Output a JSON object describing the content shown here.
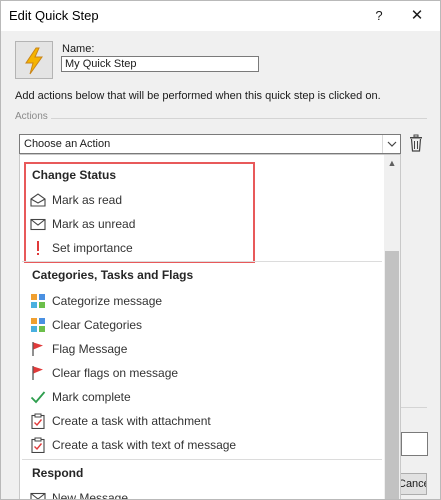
{
  "window": {
    "title": "Edit Quick Step",
    "help_label": "?",
    "close_label": "✕"
  },
  "quick_step": {
    "icon": "lightning-bolt-icon",
    "name_label": "Name:",
    "name_value": "My Quick Step"
  },
  "instructions": "Add actions below that will be performed when this quick step is clicked on.",
  "actions": {
    "section_label": "Actions",
    "select_value": "Choose an Action"
  },
  "dropdown": {
    "groups": [
      {
        "header": "Change Status",
        "items": [
          {
            "label": "Mark as read",
            "icon": "open-envelope-icon"
          },
          {
            "label": "Mark as unread",
            "icon": "envelope-icon"
          },
          {
            "label": "Set importance",
            "icon": "exclamation-icon"
          }
        ]
      },
      {
        "header": "Categories, Tasks and Flags",
        "items": [
          {
            "label": "Categorize message",
            "icon": "categorize-icon"
          },
          {
            "label": "Clear Categories",
            "icon": "clear-categories-icon"
          },
          {
            "label": "Flag Message",
            "icon": "red-flag-icon"
          },
          {
            "label": "Clear flags on message",
            "icon": "red-flag-icon"
          },
          {
            "label": "Mark complete",
            "icon": "green-check-icon"
          },
          {
            "label": "Create a task with attachment",
            "icon": "task-clipboard-icon"
          },
          {
            "label": "Create a task with text of message",
            "icon": "task-clipboard-icon"
          }
        ]
      },
      {
        "header": "Respond",
        "items": [
          {
            "label": "New Message",
            "icon": "envelope-icon"
          }
        ]
      }
    ]
  },
  "footer": {
    "cancel_label": "Cancel"
  },
  "colors": {
    "highlight": "#e8595a",
    "flag": "#e03a3a",
    "check": "#2e9e4e",
    "bolt": "#f2a000"
  }
}
